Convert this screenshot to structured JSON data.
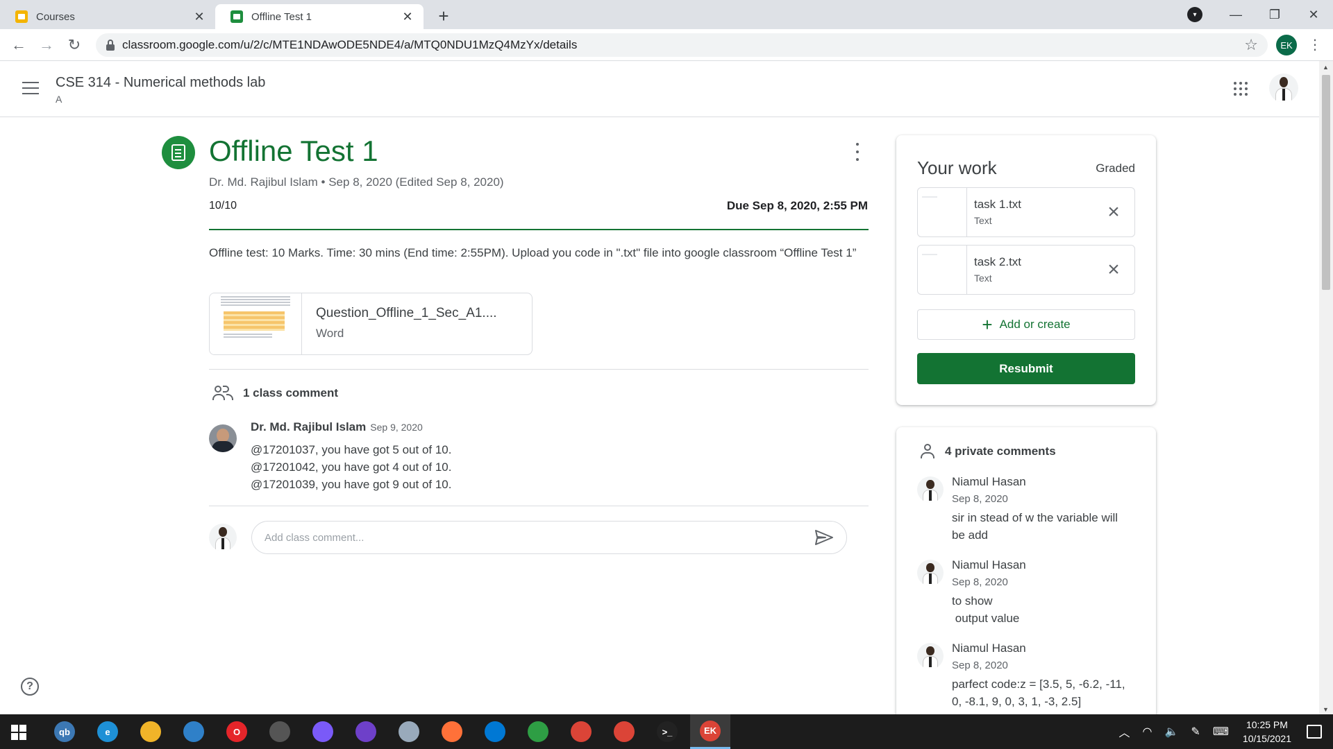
{
  "browser": {
    "tabs": [
      {
        "title": "Courses",
        "active": false
      },
      {
        "title": "Offline Test 1",
        "active": true
      }
    ],
    "new_tab_label": "+",
    "url": "classroom.google.com/u/2/c/MTE1NDAwODE5NDE4/a/MTQ0NDU1MzQ4MzYx/details",
    "profile_initials": "EK"
  },
  "header": {
    "course_title": "CSE 314 - Numerical methods lab",
    "course_section": "A"
  },
  "assignment": {
    "title": "Offline Test 1",
    "meta": "Dr. Md. Rajibul Islam • Sep 8, 2020 (Edited Sep 8, 2020)",
    "points": "10/10",
    "due": "Due Sep 8, 2020, 2:55 PM",
    "description": "Offline test: 10 Marks. Time: 30 mins (End time: 2:55PM). Upload you code in \".txt\" file into google classroom “Offline Test 1”",
    "attachment": {
      "name": "Question_Offline_1_Sec_A1....",
      "type": "Word"
    }
  },
  "class_comments": {
    "heading": "1 class comment",
    "items": [
      {
        "author": "Dr. Md. Rajibul Islam",
        "date": "Sep 9, 2020",
        "lines": [
          "@17201037, you have got 5 out of 10.",
          "@17201042, you have got 4 out of 10.",
          "@17201039, you have got 9 out of 10."
        ]
      }
    ],
    "input_placeholder": "Add class comment..."
  },
  "your_work": {
    "title": "Your work",
    "status": "Graded",
    "files": [
      {
        "name": "task 1.txt",
        "type": "Text"
      },
      {
        "name": "task 2.txt",
        "type": "Text"
      }
    ],
    "add_label": "Add or create",
    "resubmit_label": "Resubmit"
  },
  "private_comments": {
    "heading": "4 private comments",
    "items": [
      {
        "author": "Niamul Hasan",
        "date": "Sep 8, 2020",
        "text": "sir in stead of w the variable will be add"
      },
      {
        "author": "Niamul Hasan",
        "date": "Sep 8, 2020",
        "text": "to show\n output value"
      },
      {
        "author": "Niamul Hasan",
        "date": "Sep 8, 2020",
        "text": "parfect code:z = [3.5, 5, -6.2, -11, 0, -8.1, 9, 0, 3, 1, -3, 2.5]"
      }
    ]
  },
  "taskbar": {
    "clock_time": "10:25 PM",
    "clock_date": "10/15/2021",
    "apps": [
      "qbittorrent-icon",
      "edge-icon",
      "file-explorer-icon",
      "mail-icon",
      "opera-icon",
      "inkscape-icon",
      "messenger-icon",
      "github-icon",
      "paint-icon",
      "firefox-icon",
      "vscode-icon",
      "chart-app-icon",
      "chrome-icon",
      "chrome-icon",
      "terminal-icon",
      "chrome-profile-icon"
    ],
    "app_glyphs": [
      "qb",
      "e",
      "",
      "",
      "O",
      "",
      "",
      "",
      "",
      "",
      "",
      "",
      "",
      "",
      ">_",
      "EK"
    ]
  },
  "colors": {
    "accent_green": "#137333",
    "button_green": "#137333",
    "taskbar_bg": "#1c1c1c"
  }
}
